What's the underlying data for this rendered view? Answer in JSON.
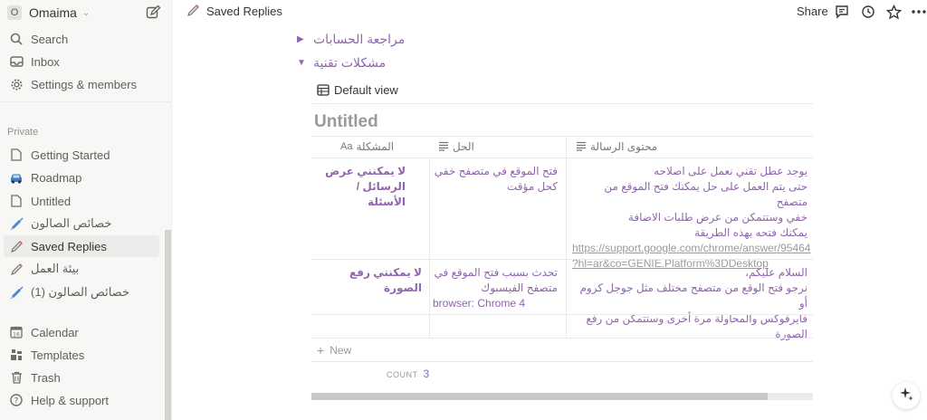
{
  "sidebar": {
    "workspace_initial": "O",
    "workspace_name": "Omaima",
    "top_items": [
      {
        "label": "Search",
        "icon": "search-icon"
      },
      {
        "label": "Inbox",
        "icon": "inbox-icon"
      },
      {
        "label": "Settings & members",
        "icon": "gear-icon"
      }
    ],
    "section_label": "Private",
    "pages": [
      {
        "label": "Getting Started",
        "icon": "page-icon"
      },
      {
        "label": "Roadmap",
        "icon": "car-icon"
      },
      {
        "label": "Untitled",
        "icon": "page-icon"
      },
      {
        "label": "خصائص الصالون",
        "icon": "syringe-icon"
      },
      {
        "label": "Saved Replies",
        "icon": "pencil-icon",
        "active": true
      },
      {
        "label": "بيئة العمل",
        "icon": "pencil-icon"
      },
      {
        "label": "خصائص الصالون (1)",
        "icon": "syringe-icon"
      }
    ],
    "bottom_items": [
      {
        "label": "Calendar",
        "icon": "calendar-icon"
      },
      {
        "label": "Templates",
        "icon": "templates-icon"
      },
      {
        "label": "Trash",
        "icon": "trash-icon"
      },
      {
        "label": "Help & support",
        "icon": "help-icon"
      }
    ]
  },
  "topbar": {
    "title": "Saved Replies",
    "share_label": "Share"
  },
  "toggles": [
    {
      "label": "مراجعة الحسابات",
      "open": false
    },
    {
      "label": "مشكلات تقنية",
      "open": true
    }
  ],
  "database": {
    "view_label": "Default view",
    "title": "Untitled",
    "columns": [
      {
        "label": "المشكلة",
        "icon": "Aa"
      },
      {
        "label": "الحل",
        "icon": "text-icon"
      },
      {
        "label": "محتوى الرسالة",
        "icon": "text-icon"
      }
    ],
    "rows": [
      {
        "problem": "لا يمكنني عرض الرسائل / الأسئلة",
        "solution": "فتح الموقع في متصفح خفي كحل مؤقت",
        "message_lines": [
          "يوجد عطل تقني نعمل على اصلاحه",
          "حتى يتم العمل على حل يمكنك فتح الموقع من متصفح",
          "خفي وستتمكن من عرض طلبات الاضافة",
          "يمكنك فتحه بهذه الطريقة"
        ],
        "message_url_1": "https://support.google.com/chrome/answer/95464",
        "message_url_2": "?hl=ar&co=GENIE.Platform%3DDesktop"
      },
      {
        "problem": "لا يمكنني رفع الصورة",
        "solution_lines": [
          "تحدث بسبب فتح الموقع في",
          "متصفح الفيسبوك"
        ],
        "solution_en": "browser: Chrome 4",
        "message_lines": [
          "السلام عليكم،",
          "نرجو فتح الوقع من متصفح مختلف مثل جوجل كروم أو",
          "فايرفوكس والمحاولة مرة أخرى وستتمكن من رفع الصورة"
        ]
      }
    ],
    "new_label": "New",
    "count_label": "COUNT",
    "count_value": "3",
    "scroll_fraction": 0.91
  },
  "colors": {
    "accent_purple": "#9065b0",
    "sidebar_bg": "#f7f7f5",
    "text_muted": "#9b9a97"
  }
}
